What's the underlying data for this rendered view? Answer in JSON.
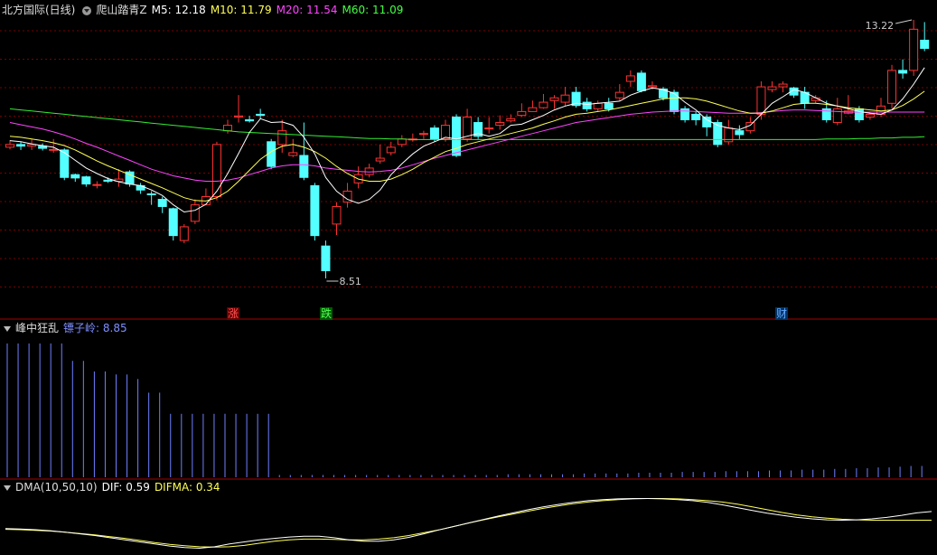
{
  "main_panel": {
    "title": "北方国际(日线)",
    "indicator_name": "爬山踏青Z",
    "ma5": "M5: 12.18",
    "ma10": "M10: 11.79",
    "ma20": "M20: 11.54",
    "ma60": "M60: 11.09",
    "high_label": "13.22",
    "low_label": "8.51",
    "signals": [
      {
        "text": "涨",
        "color": "#ff5555",
        "bg": "#6a0000"
      },
      {
        "text": "跌",
        "color": "#55ff55",
        "bg": "#005a00"
      },
      {
        "text": "财",
        "color": "#66aaff",
        "bg": "#003366"
      }
    ]
  },
  "sub_panel_1": {
    "name": "峰中狂乱",
    "value_label": "镖子岭: 8.85"
  },
  "sub_panel_2": {
    "name": "DMA(10,50,10)",
    "dif": "DIF: 0.59",
    "difma": "DIFMA: 0.34"
  },
  "colors": {
    "up": "#ff3232",
    "down": "#54ffff",
    "ma5": "#ffffff",
    "ma10": "#ffff55",
    "ma20": "#ff44ff",
    "ma60": "#33ee33",
    "bars": "#6f7fff",
    "grid": "#7a0000"
  },
  "chart_data": {
    "type": "candlestick",
    "price_range": [
      8.51,
      13.22
    ],
    "candles": [
      [
        10.9,
        10.95,
        11.03,
        10.86
      ],
      [
        10.95,
        10.92,
        11.0,
        10.85
      ],
      [
        10.92,
        10.95,
        11.05,
        10.85
      ],
      [
        10.92,
        10.88,
        10.97,
        10.84
      ],
      [
        10.85,
        10.86,
        11.05,
        10.8
      ],
      [
        10.85,
        10.35,
        10.88,
        10.3
      ],
      [
        10.4,
        10.34,
        10.42,
        10.27
      ],
      [
        10.36,
        10.23,
        10.38,
        10.18
      ],
      [
        10.22,
        10.22,
        10.28,
        10.15
      ],
      [
        10.3,
        10.28,
        10.35,
        10.25
      ],
      [
        10.28,
        10.32,
        10.5,
        10.18
      ],
      [
        10.45,
        10.23,
        10.48,
        10.18
      ],
      [
        10.2,
        10.12,
        10.25,
        10.05
      ],
      [
        10.05,
        10.04,
        10.1,
        9.85
      ],
      [
        9.95,
        9.82,
        10.0,
        9.7
      ],
      [
        9.78,
        9.29,
        9.8,
        9.2
      ],
      [
        9.2,
        9.45,
        9.5,
        9.15
      ],
      [
        9.55,
        9.85,
        9.95,
        9.5
      ],
      [
        9.85,
        10.0,
        10.15,
        9.85
      ],
      [
        10.0,
        10.95,
        11.0,
        9.93
      ],
      [
        11.2,
        11.3,
        11.4,
        11.15
      ],
      [
        11.45,
        11.47,
        11.85,
        11.35
      ],
      [
        11.4,
        11.38,
        11.47,
        11.35
      ],
      [
        11.5,
        11.48,
        11.6,
        11.42
      ],
      [
        11.0,
        10.55,
        11.05,
        10.5
      ],
      [
        10.95,
        11.2,
        11.4,
        10.8
      ],
      [
        10.75,
        10.8,
        11.05,
        10.72
      ],
      [
        10.75,
        10.35,
        11.35,
        10.3
      ],
      [
        10.2,
        9.29,
        10.25,
        9.2
      ],
      [
        9.1,
        8.65,
        9.2,
        8.51
      ],
      [
        9.5,
        9.82,
        9.9,
        9.3
      ],
      [
        9.9,
        10.1,
        10.25,
        9.8
      ],
      [
        10.25,
        10.4,
        10.55,
        10.15
      ],
      [
        10.4,
        10.52,
        10.6,
        10.35
      ],
      [
        10.65,
        10.7,
        10.95,
        10.6
      ],
      [
        10.8,
        10.9,
        11.0,
        10.75
      ],
      [
        10.95,
        11.05,
        11.12,
        10.9
      ],
      [
        11.05,
        11.05,
        11.15,
        11.0
      ],
      [
        11.15,
        11.15,
        11.2,
        11.05
      ],
      [
        11.25,
        11.05,
        11.3,
        11.0
      ],
      [
        11.05,
        11.3,
        11.4,
        11.0
      ],
      [
        11.45,
        10.75,
        11.5,
        10.72
      ],
      [
        11.05,
        11.45,
        11.6,
        11.0
      ],
      [
        11.35,
        11.1,
        11.45,
        11.05
      ],
      [
        11.25,
        11.25,
        11.45,
        11.15
      ],
      [
        11.3,
        11.35,
        11.48,
        11.22
      ],
      [
        11.38,
        11.42,
        11.5,
        11.35
      ],
      [
        11.48,
        11.55,
        11.7,
        11.45
      ],
      [
        11.55,
        11.62,
        11.75,
        11.55
      ],
      [
        11.62,
        11.72,
        11.87,
        11.6
      ],
      [
        11.75,
        11.8,
        11.85,
        11.6
      ],
      [
        11.72,
        11.85,
        12.0,
        11.65
      ],
      [
        11.9,
        11.66,
        12.0,
        11.62
      ],
      [
        11.72,
        11.6,
        11.8,
        11.55
      ],
      [
        11.6,
        11.7,
        11.75,
        11.55
      ],
      [
        11.7,
        11.6,
        11.8,
        11.55
      ],
      [
        11.8,
        11.9,
        12.05,
        11.75
      ],
      [
        12.1,
        12.2,
        12.3,
        12.0
      ],
      [
        12.25,
        11.93,
        12.3,
        11.9
      ],
      [
        12.0,
        12.02,
        12.1,
        11.95
      ],
      [
        11.96,
        11.8,
        12.0,
        11.75
      ],
      [
        11.9,
        11.55,
        11.95,
        11.5
      ],
      [
        11.6,
        11.4,
        11.65,
        11.35
      ],
      [
        11.5,
        11.4,
        11.55,
        11.3
      ],
      [
        11.45,
        11.27,
        11.5,
        11.1
      ],
      [
        11.35,
        10.95,
        11.4,
        10.9
      ],
      [
        11.0,
        11.25,
        11.4,
        10.95
      ],
      [
        11.2,
        11.13,
        11.3,
        11.05
      ],
      [
        11.2,
        11.35,
        11.45,
        11.15
      ],
      [
        11.5,
        12.0,
        12.1,
        11.4
      ],
      [
        11.95,
        12.0,
        12.1,
        11.9
      ],
      [
        12.0,
        12.05,
        12.1,
        11.9
      ],
      [
        11.98,
        11.85,
        12.0,
        11.8
      ],
      [
        11.9,
        11.7,
        12.0,
        11.6
      ],
      [
        11.75,
        11.8,
        11.85,
        11.7
      ],
      [
        11.6,
        11.4,
        11.75,
        11.35
      ],
      [
        11.35,
        11.6,
        11.8,
        11.3
      ],
      [
        11.52,
        11.56,
        11.85,
        11.5
      ],
      [
        11.6,
        11.4,
        11.65,
        11.35
      ],
      [
        11.45,
        11.5,
        11.55,
        11.4
      ],
      [
        11.5,
        11.65,
        11.8,
        11.45
      ],
      [
        11.7,
        12.3,
        12.4,
        11.6
      ],
      [
        12.3,
        12.25,
        12.5,
        12.15
      ],
      [
        12.3,
        13.05,
        13.22,
        12.2
      ],
      [
        12.85,
        12.7,
        13.18,
        12.65
      ]
    ],
    "ma5": [
      11.02,
      11.0,
      10.96,
      10.93,
      10.9,
      10.8,
      10.66,
      10.52,
      10.42,
      10.33,
      10.27,
      10.23,
      10.2,
      10.12,
      10.02,
      9.85,
      9.72,
      9.75,
      9.86,
      10.1,
      10.42,
      10.79,
      11.17,
      11.42,
      11.35,
      11.36,
      11.3,
      11.08,
      10.78,
      10.35,
      10.1,
      9.95,
      9.88,
      9.95,
      10.12,
      10.4,
      10.6,
      10.78,
      10.92,
      11.0,
      11.08,
      11.05,
      11.1,
      11.15,
      11.1,
      11.15,
      11.3,
      11.32,
      11.4,
      11.48,
      11.58,
      11.65,
      11.7,
      11.68,
      11.7,
      11.72,
      11.74,
      11.85,
      11.92,
      11.98,
      11.95,
      11.88,
      11.72,
      11.58,
      11.4,
      11.3,
      11.25,
      11.22,
      11.3,
      11.5,
      11.7,
      11.82,
      11.95,
      11.9,
      11.8,
      11.7,
      11.65,
      11.6,
      11.55,
      11.52,
      11.5,
      11.58,
      11.78,
      12.05,
      12.35
    ],
    "ma10": [
      11.1,
      11.08,
      11.05,
      11.02,
      10.98,
      10.93,
      10.85,
      10.75,
      10.65,
      10.56,
      10.48,
      10.4,
      10.32,
      10.24,
      10.16,
      10.07,
      9.98,
      9.93,
      9.92,
      9.98,
      10.1,
      10.28,
      10.48,
      10.68,
      10.82,
      10.92,
      10.95,
      10.9,
      10.82,
      10.7,
      10.55,
      10.42,
      10.32,
      10.28,
      10.28,
      10.32,
      10.4,
      10.5,
      10.62,
      10.72,
      10.82,
      10.88,
      10.95,
      11.0,
      11.05,
      11.1,
      11.15,
      11.2,
      11.25,
      11.32,
      11.38,
      11.45,
      11.5,
      11.52,
      11.55,
      11.58,
      11.62,
      11.66,
      11.7,
      11.74,
      11.78,
      11.8,
      11.8,
      11.78,
      11.74,
      11.68,
      11.62,
      11.56,
      11.52,
      11.52,
      11.56,
      11.62,
      11.68,
      11.7,
      11.7,
      11.68,
      11.65,
      11.62,
      11.6,
      11.58,
      11.56,
      11.58,
      11.66,
      11.78,
      11.92
    ],
    "ma20": [
      11.35,
      11.31,
      11.27,
      11.23,
      11.18,
      11.12,
      11.05,
      10.97,
      10.9,
      10.82,
      10.74,
      10.66,
      10.58,
      10.5,
      10.44,
      10.38,
      10.34,
      10.3,
      10.28,
      10.28,
      10.3,
      10.34,
      10.4,
      10.46,
      10.52,
      10.56,
      10.58,
      10.58,
      10.56,
      10.52,
      10.5,
      10.48,
      10.46,
      10.45,
      10.46,
      10.48,
      10.52,
      10.58,
      10.64,
      10.7,
      10.75,
      10.8,
      10.85,
      10.9,
      10.95,
      11.0,
      11.05,
      11.1,
      11.15,
      11.2,
      11.25,
      11.3,
      11.35,
      11.38,
      11.41,
      11.44,
      11.47,
      11.5,
      11.52,
      11.54,
      11.55,
      11.56,
      11.56,
      11.55,
      11.54,
      11.53,
      11.52,
      11.52,
      11.52,
      11.53,
      11.55,
      11.57,
      11.58,
      11.58,
      11.57,
      11.56,
      11.55,
      11.54,
      11.54,
      11.54,
      11.54,
      11.54,
      11.54,
      11.54,
      11.54
    ],
    "ma60": [
      11.6,
      11.58,
      11.56,
      11.54,
      11.52,
      11.5,
      11.48,
      11.46,
      11.44,
      11.42,
      11.4,
      11.38,
      11.36,
      11.34,
      11.32,
      11.3,
      11.28,
      11.26,
      11.24,
      11.22,
      11.2,
      11.18,
      11.17,
      11.16,
      11.15,
      11.14,
      11.13,
      11.12,
      11.11,
      11.1,
      11.09,
      11.08,
      11.07,
      11.06,
      11.06,
      11.05,
      11.05,
      11.04,
      11.04,
      11.04,
      11.04,
      11.04,
      11.04,
      11.04,
      11.04,
      11.04,
      11.04,
      11.04,
      11.04,
      11.04,
      11.04,
      11.04,
      11.04,
      11.04,
      11.04,
      11.04,
      11.04,
      11.04,
      11.04,
      11.04,
      11.04,
      11.04,
      11.04,
      11.04,
      11.04,
      11.04,
      11.04,
      11.04,
      11.04,
      11.04,
      11.04,
      11.04,
      11.04,
      11.04,
      11.04,
      11.05,
      11.05,
      11.05,
      11.06,
      11.06,
      11.07,
      11.07,
      11.08,
      11.08,
      11.09
    ],
    "sub1_bars": [
      8.85,
      8.85,
      8.85,
      8.85,
      8.85,
      8.85,
      7.7,
      7.7,
      7.0,
      7.0,
      6.8,
      6.8,
      6.5,
      5.6,
      5.6,
      4.2,
      4.2,
      4.2,
      4.2,
      4.2,
      4.2,
      4.2,
      4.2,
      4.2,
      4.2,
      0.15,
      0.15,
      0.15,
      0.15,
      0.15,
      0.15,
      0.15,
      0.15,
      0.15,
      0.15,
      0.15,
      0.15,
      0.15,
      0.15,
      0.15,
      0.15,
      0.15,
      0.15,
      0.15,
      0.15,
      0.15,
      0.2,
      0.2,
      0.2,
      0.2,
      0.2,
      0.2,
      0.2,
      0.25,
      0.25,
      0.25,
      0.25,
      0.25,
      0.3,
      0.3,
      0.3,
      0.3,
      0.35,
      0.35,
      0.35,
      0.35,
      0.4,
      0.4,
      0.4,
      0.4,
      0.45,
      0.45,
      0.45,
      0.5,
      0.5,
      0.5,
      0.55,
      0.55,
      0.6,
      0.6,
      0.65,
      0.65,
      0.7,
      0.75,
      0.75
    ],
    "sub1_max": 8.85,
    "dif": [
      0.1,
      0.09,
      0.07,
      0.04,
      0.0,
      -0.05,
      -0.1,
      -0.16,
      -0.22,
      -0.28,
      -0.34,
      -0.4,
      -0.44,
      -0.46,
      -0.42,
      -0.34,
      -0.28,
      -0.22,
      -0.18,
      -0.14,
      -0.12,
      -0.12,
      -0.16,
      -0.22,
      -0.26,
      -0.26,
      -0.22,
      -0.15,
      -0.05,
      0.06,
      0.16,
      0.26,
      0.36,
      0.46,
      0.55,
      0.64,
      0.72,
      0.79,
      0.85,
      0.9,
      0.93,
      0.95,
      0.96,
      0.96,
      0.95,
      0.93,
      0.9,
      0.85,
      0.78,
      0.7,
      0.62,
      0.54,
      0.48,
      0.42,
      0.38,
      0.35,
      0.34,
      0.35,
      0.38,
      0.42,
      0.48,
      0.55,
      0.59
    ],
    "difma": [
      0.08,
      0.07,
      0.05,
      0.03,
      0.0,
      -0.04,
      -0.08,
      -0.13,
      -0.18,
      -0.24,
      -0.3,
      -0.35,
      -0.39,
      -0.42,
      -0.43,
      -0.42,
      -0.38,
      -0.32,
      -0.26,
      -0.22,
      -0.2,
      -0.2,
      -0.21,
      -0.22,
      -0.22,
      -0.2,
      -0.16,
      -0.1,
      -0.02,
      0.06,
      0.16,
      0.26,
      0.35,
      0.44,
      0.52,
      0.6,
      0.68,
      0.75,
      0.81,
      0.86,
      0.9,
      0.93,
      0.95,
      0.96,
      0.96,
      0.95,
      0.93,
      0.9,
      0.86,
      0.8,
      0.72,
      0.64,
      0.56,
      0.49,
      0.44,
      0.4,
      0.37,
      0.35,
      0.34,
      0.34,
      0.34,
      0.34,
      0.34
    ]
  }
}
